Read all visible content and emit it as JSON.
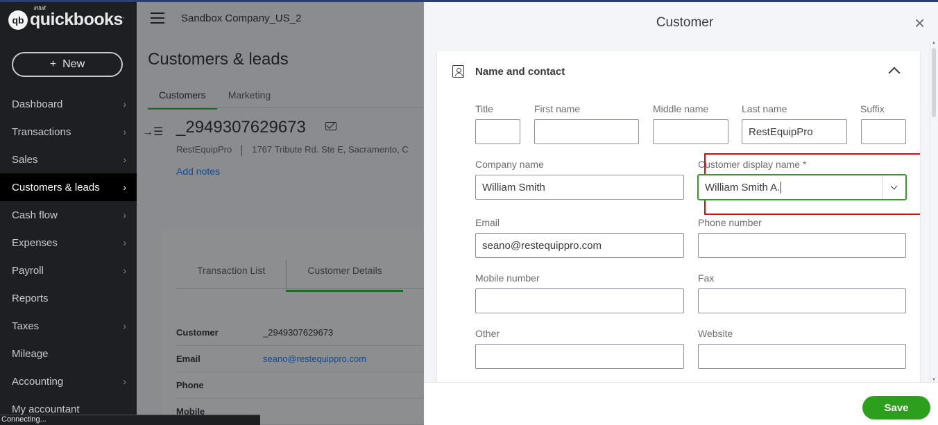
{
  "app": {
    "logo_brand": "intuit",
    "logo_name": "quickbooks",
    "new_button": "New",
    "company_name": "Sandbox Company_US_2"
  },
  "sidebar": {
    "items": [
      {
        "label": "Dashboard",
        "chevron": true
      },
      {
        "label": "Transactions",
        "chevron": true
      },
      {
        "label": "Sales",
        "chevron": true
      },
      {
        "label": "Customers & leads",
        "chevron": true,
        "active": true
      },
      {
        "label": "Cash flow",
        "chevron": true
      },
      {
        "label": "Expenses",
        "chevron": true
      },
      {
        "label": "Payroll",
        "chevron": true
      },
      {
        "label": "Reports",
        "chevron": false
      },
      {
        "label": "Taxes",
        "chevron": true
      },
      {
        "label": "Mileage",
        "chevron": false
      },
      {
        "label": "Accounting",
        "chevron": true
      },
      {
        "label": "My accountant",
        "chevron": false
      }
    ]
  },
  "page": {
    "title": "Customers & leads",
    "tabs": [
      "Customers",
      "Marketing"
    ],
    "customer_id": "_2949307629673",
    "company": "RestEquipPro",
    "address": "1767 Tribute Rd. Ste E, Sacramento, C",
    "add_notes": "Add notes",
    "inner_tabs": [
      "Transaction List",
      "Customer Details"
    ],
    "details": [
      {
        "key": "Customer",
        "value": "_2949307629673",
        "link": false
      },
      {
        "key": "Email",
        "value": "seano@restequippro.com",
        "link": true
      },
      {
        "key": "Phone",
        "value": "",
        "link": false
      },
      {
        "key": "Mobile",
        "value": "",
        "link": false
      }
    ]
  },
  "status": "Connecting...",
  "drawer": {
    "title": "Customer",
    "section_title": "Name and contact",
    "labels": {
      "title": "Title",
      "first_name": "First name",
      "middle_name": "Middle name",
      "last_name": "Last name",
      "suffix": "Suffix",
      "company_name": "Company name",
      "display_name": "Customer display name *",
      "email": "Email",
      "phone": "Phone number",
      "mobile": "Mobile number",
      "fax": "Fax",
      "other": "Other",
      "website": "Website"
    },
    "values": {
      "title": "",
      "first_name": "",
      "middle_name": "",
      "last_name": "RestEquipPro",
      "suffix": "",
      "company_name": "William Smith",
      "display_name": "William Smith A.",
      "email": "seano@restequippro.com",
      "phone": "",
      "mobile": "",
      "fax": "",
      "other": "",
      "website": ""
    },
    "save_label": "Save"
  },
  "colors": {
    "accent_green": "#2ca01c",
    "highlight_red": "#d50e0e",
    "sidebar_bg": "#1d1f22"
  }
}
